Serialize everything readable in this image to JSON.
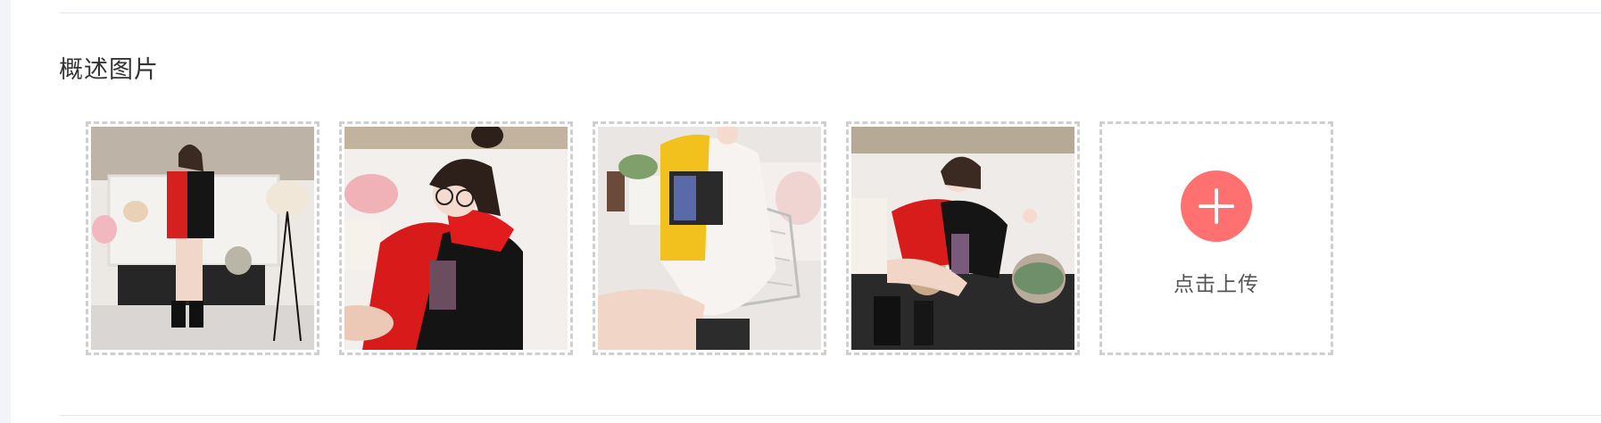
{
  "section": {
    "title": "概述图片"
  },
  "gallery": {
    "images": [
      {
        "alt": "product-photo-1"
      },
      {
        "alt": "product-photo-2"
      },
      {
        "alt": "product-photo-3"
      },
      {
        "alt": "product-photo-4"
      }
    ],
    "upload": {
      "label": "点击上传",
      "icon": "plus-icon",
      "accent": "#ff7070"
    }
  }
}
